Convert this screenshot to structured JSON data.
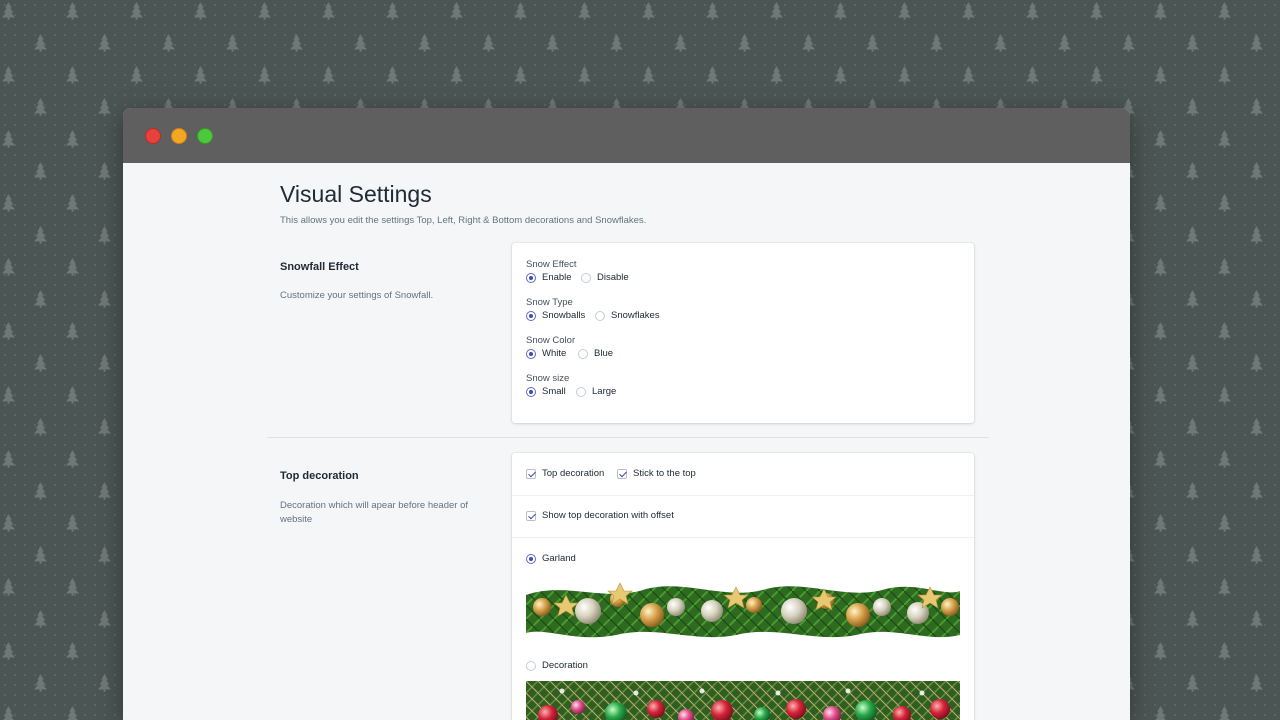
{
  "page": {
    "title": "Visual Settings",
    "description": "This allows you edit the settings Top, Left, Right & Bottom decorations and Snowflakes."
  },
  "snowfall": {
    "title": "Snowfall Effect",
    "description": "Customize your settings of Snowfall.",
    "groups": [
      {
        "label": "Snow Effect",
        "options": [
          "Enable",
          "Disable"
        ],
        "selected": "Enable"
      },
      {
        "label": "Snow Type",
        "options": [
          "Snowballs",
          "Snowflakes"
        ],
        "selected": "Snowballs"
      },
      {
        "label": "Snow Color",
        "options": [
          "White",
          "Blue"
        ],
        "selected": "White"
      },
      {
        "label": "Snow size",
        "options": [
          "Small",
          "Large"
        ],
        "selected": "Small"
      }
    ]
  },
  "top_decoration": {
    "title": "Top decoration",
    "description": "Decoration which will apear before header of website",
    "checkboxes": [
      {
        "label": "Top decoration",
        "checked": true
      },
      {
        "label": "Stick to the top",
        "checked": true
      },
      {
        "label": "Show top decoration with offset",
        "checked": true
      }
    ],
    "styles": [
      {
        "label": "Garland",
        "selected": true
      },
      {
        "label": "Decoration",
        "selected": false
      }
    ]
  },
  "window_controls": {
    "close_color": "#e8403a",
    "minimize_color": "#f5a623",
    "maximize_color": "#4cc93a"
  },
  "colors": {
    "background": "#4b5553",
    "titlebar": "#5f5f5f",
    "accent": "#3d4ab8"
  }
}
